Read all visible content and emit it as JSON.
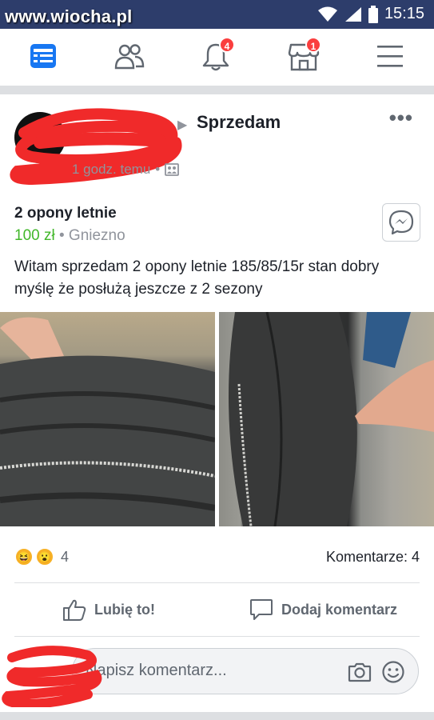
{
  "status_bar": {
    "watermark": "www.wiocha.pl",
    "time": "15:15"
  },
  "navbar": {
    "items": [
      {
        "name": "news-feed",
        "icon": "news-feed-icon",
        "active": true
      },
      {
        "name": "friends",
        "icon": "friends-icon",
        "active": false
      },
      {
        "name": "notifications",
        "icon": "bell-icon",
        "badge": "4"
      },
      {
        "name": "marketplace",
        "icon": "shop-icon",
        "badge": "1"
      },
      {
        "name": "menu",
        "icon": "hamburger-icon"
      }
    ]
  },
  "post": {
    "group_name": "Sprzedam",
    "time": "1 godz. temu",
    "privacy_separator": "•",
    "more": "•••",
    "item_title": "2 opony letnie",
    "price": "100 zł",
    "location_separator": " • ",
    "location": "Gniezno",
    "text": "Witam sprzedam 2 opony letnie 185/85/15r stan dobry myślę że posłużą jeszcze z 2 sezony",
    "reaction_count": "4",
    "comments_count": "Komentarze: 4",
    "like_label": "Lubię to!",
    "comment_label": "Dodaj komentarz"
  },
  "composer": {
    "placeholder": "Napisz komentarz..."
  },
  "colors": {
    "brand": "#2d3d6b",
    "price": "#42b72a",
    "badge": "#fa3e3e",
    "nav_active": "#1877f2",
    "redaction": "#f02a2a"
  }
}
